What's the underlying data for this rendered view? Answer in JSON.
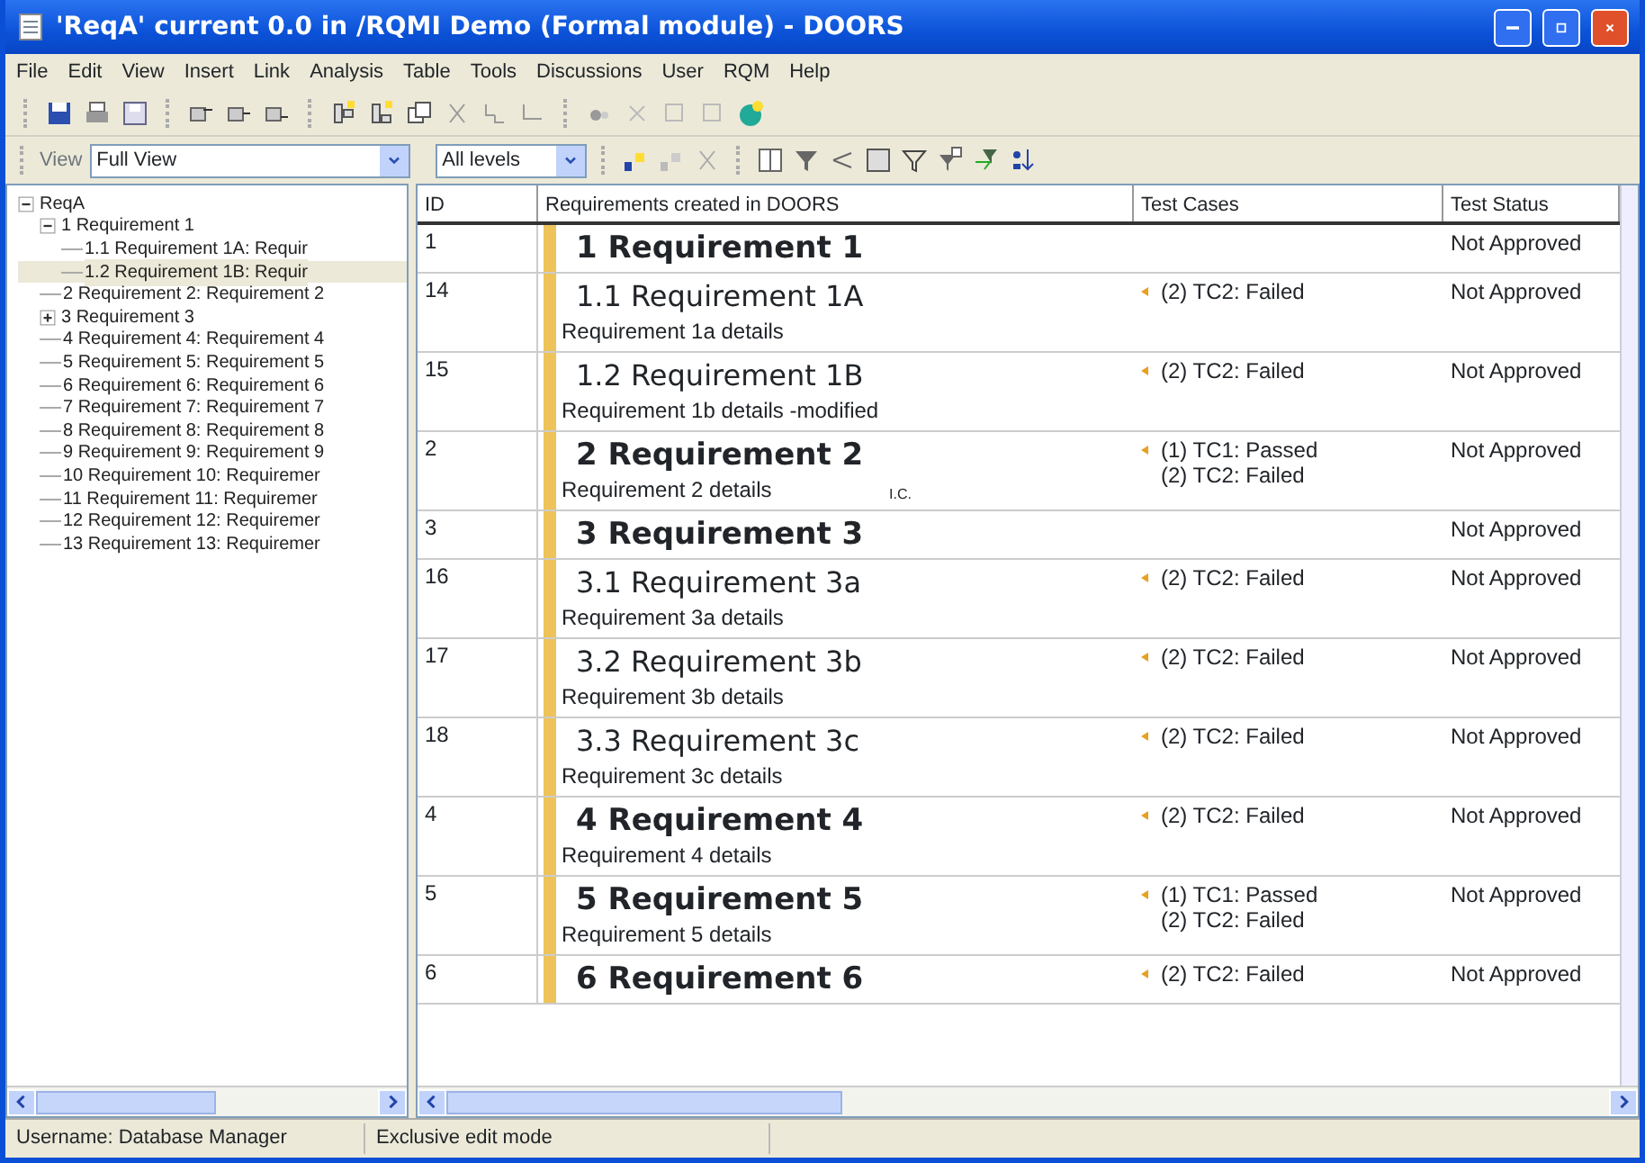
{
  "window": {
    "title": "'ReqA' current 0.0 in /RQMI Demo (Formal module) - DOORS"
  },
  "menu": [
    "File",
    "Edit",
    "View",
    "Insert",
    "Link",
    "Analysis",
    "Table",
    "Tools",
    "Discussions",
    "User",
    "RQM",
    "Help"
  ],
  "view_bar": {
    "label": "View",
    "view": "Full View",
    "levels": "All levels"
  },
  "tree": {
    "label": "ReqA",
    "expanded": true,
    "children": [
      {
        "label": "1 Requirement 1",
        "expanded": true,
        "selected": false,
        "children": [
          {
            "label": "1.1 Requirement 1A: Requir",
            "selected": false
          },
          {
            "label": "1.2 Requirement 1B: Requir",
            "selected": true
          }
        ]
      },
      {
        "label": "2 Requirement 2: Requirement 2",
        "selected": false
      },
      {
        "label": "3 Requirement 3",
        "expanded": false,
        "selected": false
      },
      {
        "label": "4 Requirement 4: Requirement 4",
        "selected": false
      },
      {
        "label": "5 Requirement 5: Requirement 5",
        "selected": false
      },
      {
        "label": "6 Requirement 6: Requirement 6",
        "selected": false
      },
      {
        "label": "7 Requirement 7: Requirement 7",
        "selected": false
      },
      {
        "label": "8 Requirement 8: Requirement 8",
        "selected": false
      },
      {
        "label": "9 Requirement 9: Requirement 9",
        "selected": false
      },
      {
        "label": "10 Requirement 10: Requiremer",
        "selected": false
      },
      {
        "label": "11 Requirement 11: Requiremer",
        "selected": false
      },
      {
        "label": "12 Requirement 12: Requiremer",
        "selected": false
      },
      {
        "label": "13 Requirement 13: Requiremer",
        "selected": false
      }
    ]
  },
  "table": {
    "columns": [
      "ID",
      "Requirements created in DOORS",
      "Test Cases",
      "Test Status"
    ],
    "rows": [
      {
        "id": "1",
        "kind": "chapter",
        "heading": "1 Requirement 1",
        "test_cases": [],
        "status": "Not Approved"
      },
      {
        "id": "14",
        "kind": "section",
        "heading": "1.1 Requirement 1A",
        "details": "Requirement 1a details",
        "test_cases": [
          "(2) TC2: Failed"
        ],
        "status": "Not Approved"
      },
      {
        "id": "15",
        "kind": "section",
        "heading": "1.2 Requirement 1B",
        "details": "Requirement 1b details -modified",
        "test_cases": [
          "(2) TC2: Failed"
        ],
        "status": "Not Approved"
      },
      {
        "id": "2",
        "kind": "chapter",
        "heading": "2 Requirement 2",
        "details": "Requirement 2 details",
        "hover_label": "I.C.",
        "test_cases": [
          "(1) TC1: Passed",
          "(2) TC2: Failed"
        ],
        "status": "Not Approved"
      },
      {
        "id": "3",
        "kind": "chapter",
        "heading": "3 Requirement 3",
        "test_cases": [],
        "status": "Not Approved"
      },
      {
        "id": "16",
        "kind": "section",
        "heading": "3.1 Requirement 3a",
        "details": "Requirement 3a details",
        "test_cases": [
          "(2) TC2: Failed"
        ],
        "status": "Not Approved"
      },
      {
        "id": "17",
        "kind": "section",
        "heading": "3.2 Requirement 3b",
        "details": "Requirement 3b details",
        "test_cases": [
          "(2) TC2: Failed"
        ],
        "status": "Not Approved"
      },
      {
        "id": "18",
        "kind": "section",
        "heading": "3.3 Requirement 3c",
        "details": "Requirement 3c details",
        "test_cases": [
          "(2) TC2: Failed"
        ],
        "status": "Not Approved"
      },
      {
        "id": "4",
        "kind": "chapter",
        "heading": "4 Requirement 4",
        "details": "Requirement 4 details",
        "test_cases": [
          "(2) TC2: Failed"
        ],
        "status": "Not Approved"
      },
      {
        "id": "5",
        "kind": "chapter",
        "heading": "5 Requirement 5",
        "details": "Requirement 5 details",
        "test_cases": [
          "(1) TC1: Passed",
          "(2) TC2: Failed"
        ],
        "status": "Not Approved"
      },
      {
        "id": "6",
        "kind": "chapter",
        "heading": "6 Requirement 6",
        "test_cases": [
          "(2) TC2: Failed"
        ],
        "status": "Not Approved"
      }
    ]
  },
  "status_bar": [
    "Username: Database Manager",
    "Exclusive edit mode"
  ]
}
